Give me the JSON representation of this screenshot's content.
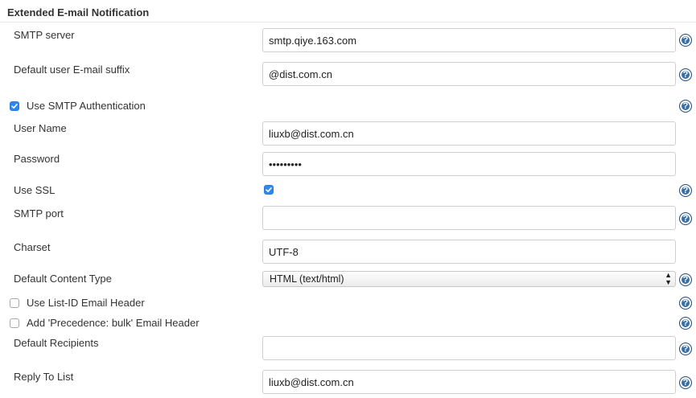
{
  "section": {
    "title": "Extended E-mail Notification"
  },
  "fields": {
    "smtp_server": {
      "label": "SMTP server",
      "value": "smtp.qiye.163.com"
    },
    "default_suffix": {
      "label": "Default user E-mail suffix",
      "value": "@dist.com.cn"
    },
    "use_smtp_auth": {
      "label": "Use SMTP Authentication",
      "checked": true
    },
    "user_name": {
      "label": "User Name",
      "value": "liuxb@dist.com.cn"
    },
    "password": {
      "label": "Password",
      "value": "•••••••••"
    },
    "use_ssl": {
      "label": "Use SSL",
      "checked": true
    },
    "smtp_port": {
      "label": "SMTP port",
      "value": ""
    },
    "charset": {
      "label": "Charset",
      "value": "UTF-8"
    },
    "content_type": {
      "label": "Default Content Type",
      "value": "HTML (text/html)"
    },
    "list_id_header": {
      "label": "Use List-ID Email Header",
      "checked": false
    },
    "precedence_header": {
      "label": "Add 'Precedence: bulk' Email Header",
      "checked": false
    },
    "default_recipients": {
      "label": "Default Recipients",
      "value": ""
    },
    "reply_to": {
      "label": "Reply To List",
      "value": "liuxb@dist.com.cn"
    }
  },
  "help": {
    "glyph": "?",
    "icon": "help-icon"
  },
  "colors": {
    "checkbox_checked": "#2d89ef",
    "help_icon": "#3a6fa4"
  }
}
